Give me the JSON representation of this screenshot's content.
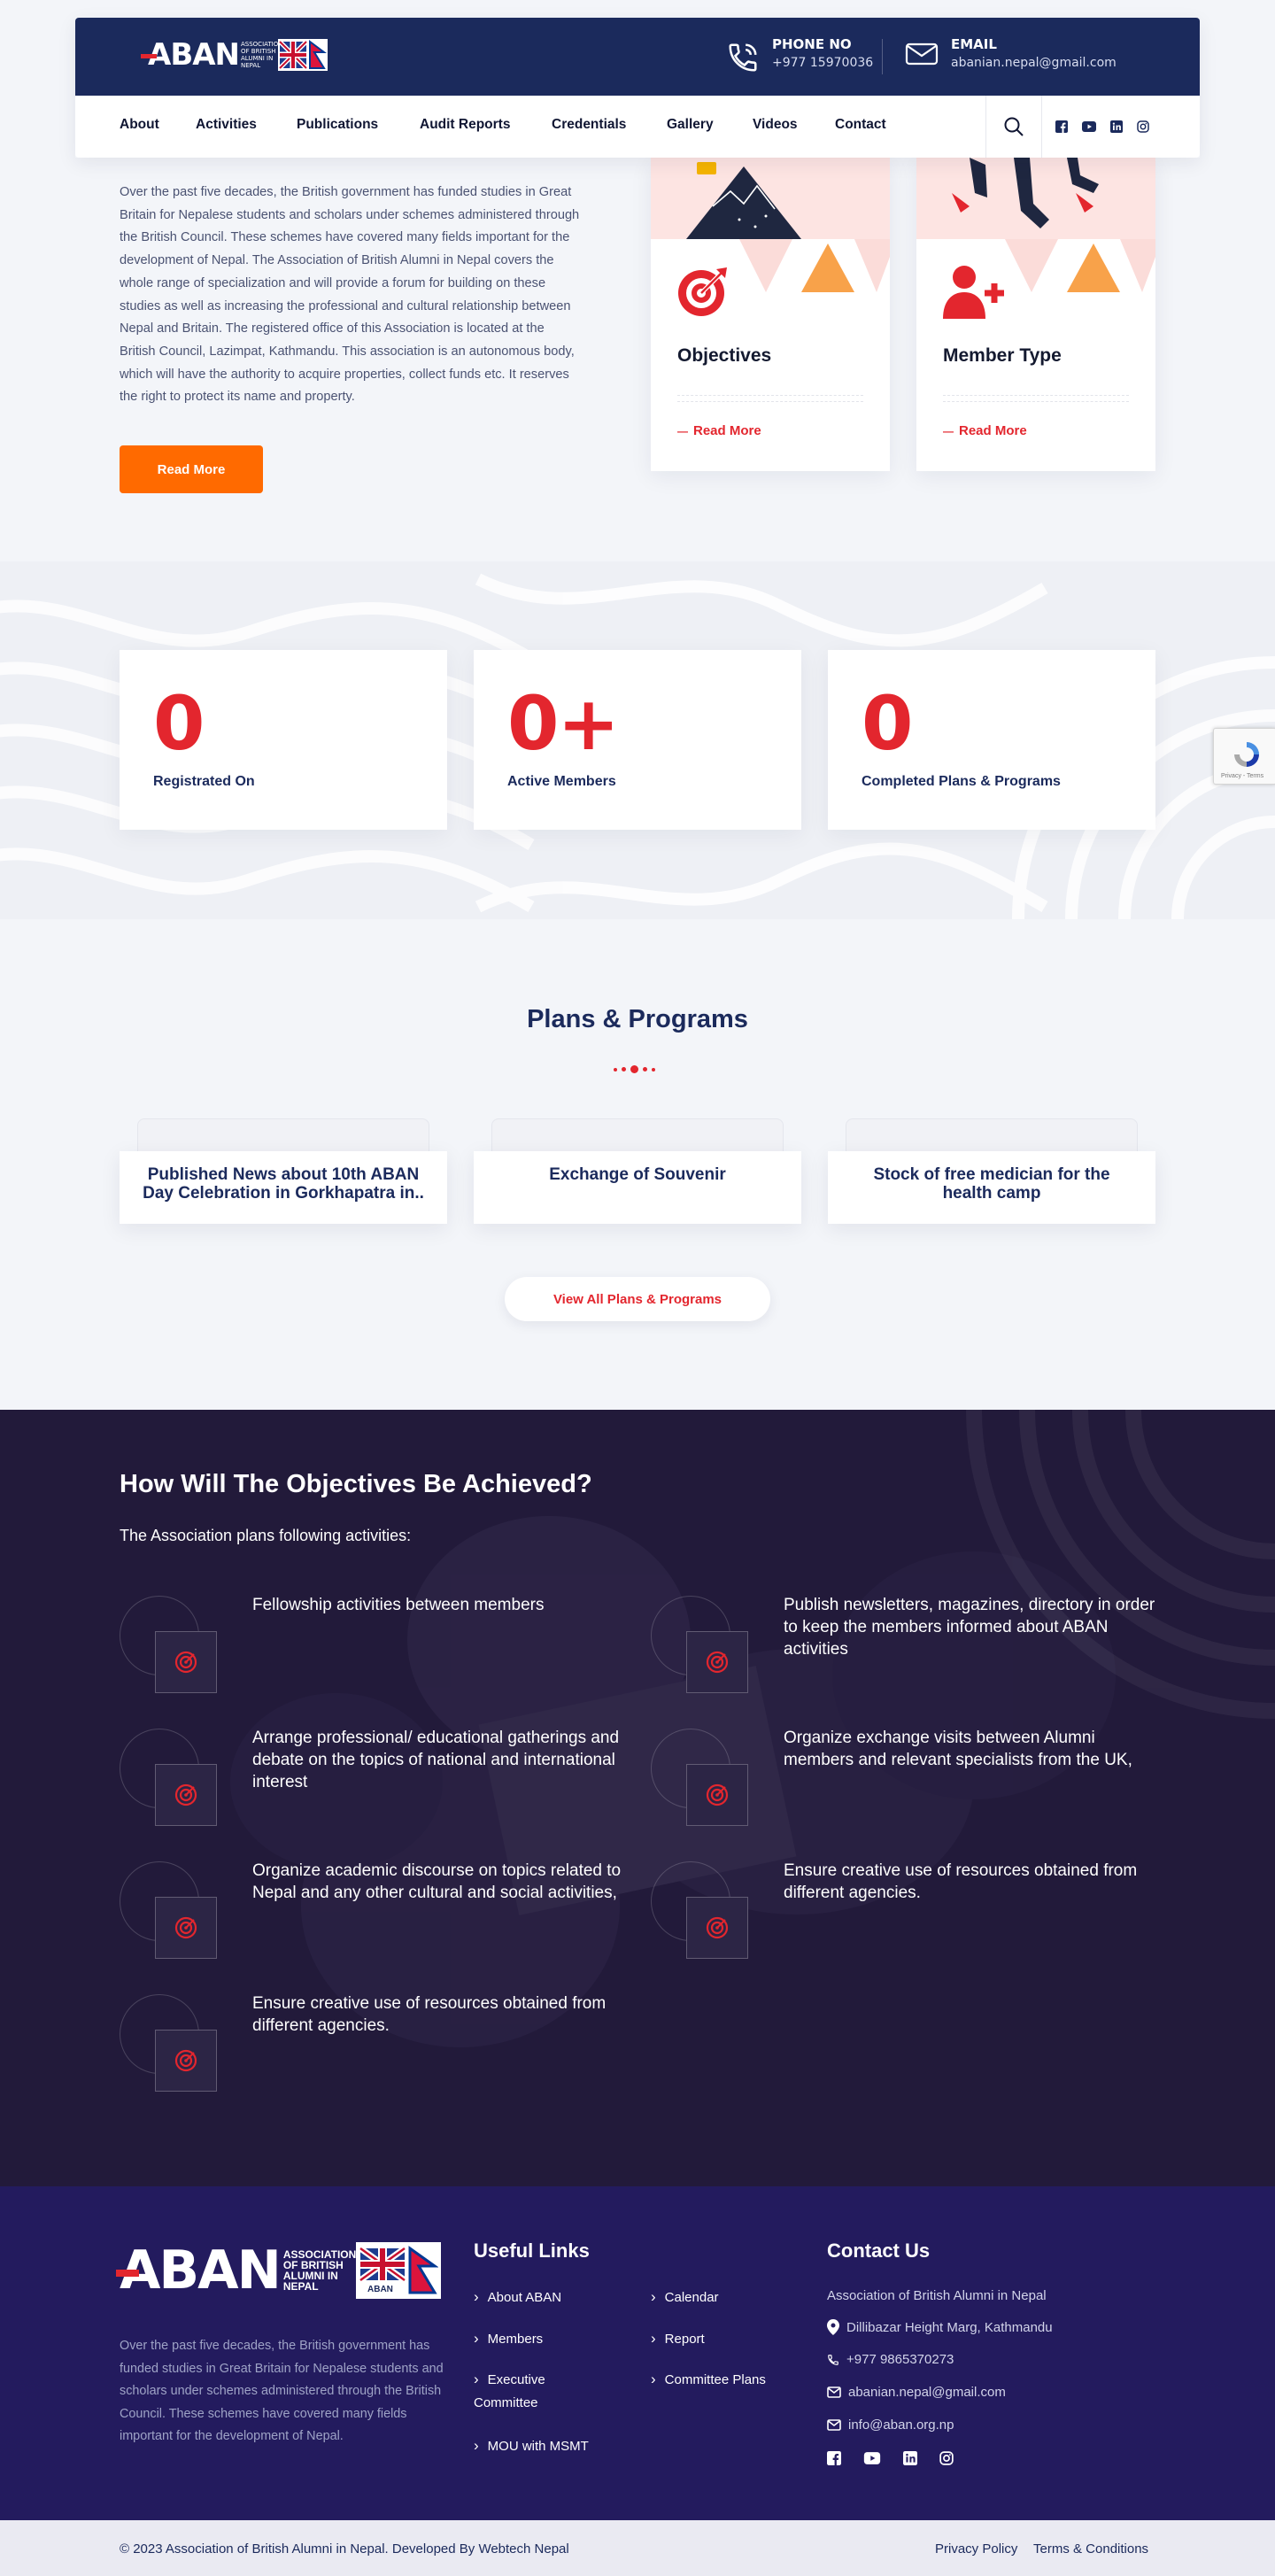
{
  "header": {
    "logo_text": "ABAN",
    "logo_sub": "ASSOCIATION OF BRITISH ALUMNI IN NEPAL",
    "phone_label": "PHONE NO",
    "phone_value": "+977 15970036",
    "email_label": "EMAIL",
    "email_value": "abanian.nepal@gmail.com"
  },
  "nav": {
    "items": [
      "About",
      "Activities",
      "Publications",
      "Audit Reports",
      "Credentials",
      "Gallery",
      "Videos",
      "Contact"
    ],
    "social_icons": [
      "facebook-icon",
      "youtube-icon",
      "linkedin-icon",
      "instagram-icon"
    ]
  },
  "about": {
    "text": "Over the past five decades, the British government has funded studies in Great Britain for Nepalese students and scholars under schemes administered through the British Council. These schemes have covered many fields important for the development of Nepal. The Association of British Alumni in Nepal covers the whole range of specialization and will provide a forum for building on these studies as well as increasing the professional and cultural relationship between Nepal and Britain. The registered office of this Association is located at the British Council, Lazimpat, Kathmandu. This association is an autonomous body, which will have the authority to acquire properties, collect funds etc. It reserves the right to protect its name and property.",
    "button_label": "Read More",
    "cards": [
      {
        "title": "Objectives",
        "link": "Read More",
        "icon": "target-icon"
      },
      {
        "title": "Member Type",
        "link": "Read More",
        "icon": "add-user-icon"
      }
    ]
  },
  "stats": [
    {
      "value": "0",
      "label": "Registrated On"
    },
    {
      "value": "0+",
      "label": "Active Members"
    },
    {
      "value": "0",
      "label": "Completed Plans & Programs"
    }
  ],
  "recaptcha": {
    "text": "Privacy - Terms"
  },
  "plans": {
    "title": "Plans & Programs",
    "cards": [
      {
        "title": "Published News about 10th ABAN\nDay Celebration in Gorkhapatra in.."
      },
      {
        "title": "Exchange of Souvenir"
      },
      {
        "title": "Stock of free medician for the\nhealth camp"
      }
    ],
    "button_label": "View All Plans & Programs"
  },
  "objectives": {
    "title": "How Will The Objectives Be Achieved?",
    "subtitle": "The Association plans following activities:",
    "items": [
      "Fellowship activities between members",
      "Publish newsletters, magazines, directory in order to keep the members informed about ABAN activities",
      "Arrange professional/ educational gatherings and debate on the topics of national and international interest",
      "Organize exchange visits between Alumni members and relevant specialists from the UK,",
      "Organize academic discourse on topics related to Nepal and any other cultural and social activities,",
      "Ensure creative use of resources obtained from different agencies.",
      "Ensure creative use of resources obtained from different agencies."
    ]
  },
  "footer": {
    "logo_text": "ABAN",
    "logo_sub": "ASSOCIATION OF BRITISH ALUMNI IN NEPAL",
    "about": "Over the past five decades, the British government has funded studies in Great Britain for Nepalese students and scholars under schemes administered through the British Council. These schemes have covered many fields important for the development of Nepal.",
    "links_title": "Useful Links",
    "links_col1": [
      "About ABAN",
      "Members",
      "Executive Committee",
      "MOU with MSMT"
    ],
    "links_col2": [
      "Calendar",
      "Report",
      "Committee Plans"
    ],
    "contact_title": "Contact Us",
    "org_name": "Association of British Alumni in Nepal",
    "address": "Dillibazar Height Marg, Kathmandu",
    "phone": "+977 9865370273",
    "email1": "abanian.nepal@gmail.com",
    "email2": "info@aban.org.np",
    "copyright": "© 2023 Association of British Alumni in Nepal. Developed By Webtech Nepal",
    "privacy": "Privacy Policy",
    "terms": "Terms & Conditions"
  },
  "colors": {
    "navy": "#1b2a5c",
    "accent_red": "#e3262e",
    "accent_orange": "#ff6a00",
    "dark_band": "#221a3a",
    "footer_bg": "#231b5e"
  }
}
